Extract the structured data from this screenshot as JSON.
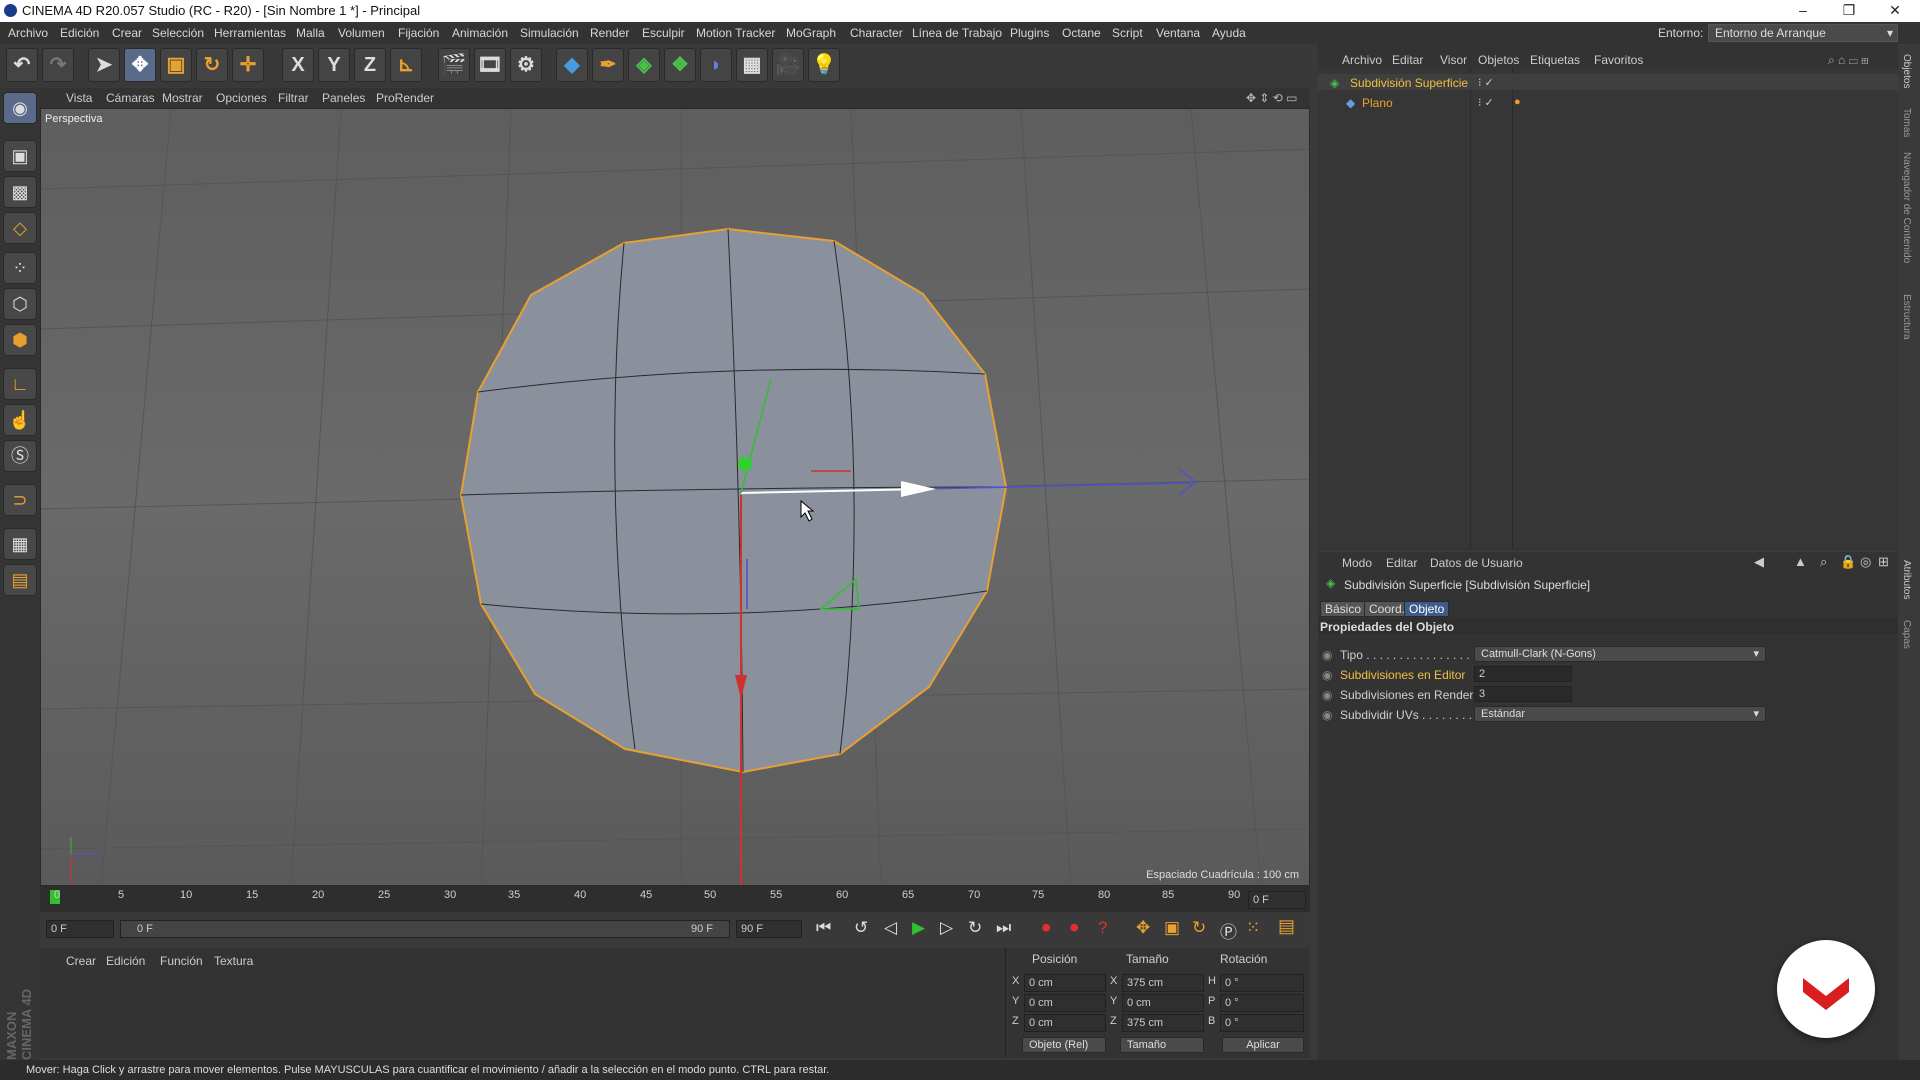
{
  "window": {
    "title": "CINEMA 4D R20.057 Studio (RC - R20) - [Sin Nombre 1 *] - Principal",
    "minimize": "–",
    "maximize": "❐",
    "close": "✕"
  },
  "menu": [
    "Archivo",
    "Edición",
    "Crear",
    "Selección",
    "Herramientas",
    "Malla",
    "Volumen",
    "Fijación",
    "Animación",
    "Simulación",
    "Render",
    "Esculpir",
    "Motion Tracker",
    "MoGraph",
    "Character",
    "Línea de Trabajo",
    "Plugins",
    "Octane",
    "Script",
    "Ventana",
    "Ayuda"
  ],
  "environment": {
    "label": "Entorno:",
    "value": "Entorno de Arranque"
  },
  "toolbar": {
    "x": "X",
    "y": "Y",
    "z": "Z"
  },
  "viewport": {
    "menu": [
      "Vista",
      "Cámaras",
      "Mostrar",
      "Opciones",
      "Filtrar",
      "Paneles",
      "ProRender"
    ],
    "label": "Perspectiva",
    "grid": "Espaciado Cuadrícula : 100 cm"
  },
  "timeline": {
    "ticks": [
      "0",
      "5",
      "10",
      "15",
      "20",
      "25",
      "30",
      "35",
      "40",
      "45",
      "50",
      "55",
      "60",
      "65",
      "70",
      "75",
      "80",
      "85",
      "90"
    ],
    "current": "0 F",
    "start": "0 F",
    "slider_left": "0 F",
    "slider_right": "90 F",
    "end": "90 F"
  },
  "material": {
    "menu": [
      "Crear",
      "Edición",
      "Función",
      "Textura"
    ]
  },
  "coords": {
    "headers": [
      "Posición",
      "Tamaño",
      "Rotación"
    ],
    "rows": [
      {
        "axis": "X",
        "pos": "0 cm",
        "size_axis": "X",
        "size": "375 cm",
        "rot_axis": "H",
        "rot": "0 °"
      },
      {
        "axis": "Y",
        "pos": "0 cm",
        "size_axis": "Y",
        "size": "0 cm",
        "rot_axis": "P",
        "rot": "0 °"
      },
      {
        "axis": "Z",
        "pos": "0 cm",
        "size_axis": "Z",
        "size": "375 cm",
        "rot_axis": "B",
        "rot": "0 °"
      }
    ],
    "mode": "Objeto (Rel)",
    "size_mode": "Tamaño",
    "apply": "Aplicar"
  },
  "objects": {
    "menu": [
      "Archivo",
      "Editar",
      "Visor",
      "Objetos",
      "Etiquetas",
      "Favoritos"
    ],
    "items": [
      {
        "name": "Subdivisión Superficie"
      },
      {
        "name": "Plano"
      }
    ]
  },
  "attributes": {
    "menu": [
      "Modo",
      "Editar",
      "Datos de Usuario"
    ],
    "header": "Subdivisión Superficie [Subdivisión Superficie]",
    "tabs": [
      "Básico",
      "Coord.",
      "Objeto"
    ],
    "section": "Propiedades del Objeto",
    "props": [
      {
        "label": "Tipo . . . . . . . . . . . . . . . . .",
        "value": "Catmull-Clark (N-Gons)"
      },
      {
        "label": "Subdivisiones en Editor",
        "value": "2"
      },
      {
        "label": "Subdivisiones en Render",
        "value": "3"
      },
      {
        "label": "Subdividir UVs . . . . . . . . .",
        "value": "Estándar"
      }
    ]
  },
  "side_tabs": [
    "Objetos",
    "Tomas",
    "Navegador de Contenido",
    "Estructura"
  ],
  "side_tabs2": [
    "Atributos",
    "Capas"
  ],
  "brand": "MAXON CINEMA 4D",
  "status": "Mover: Haga Click y arrastre para mover elementos. Pulse MAYUSCULAS para cuantificar el movimiento / añadir a la selección en el modo punto. CTRL para restar.",
  "colors": {
    "accent": "#e8a030",
    "selected": "#f0c040",
    "tab_active": "#3d5a8a"
  }
}
